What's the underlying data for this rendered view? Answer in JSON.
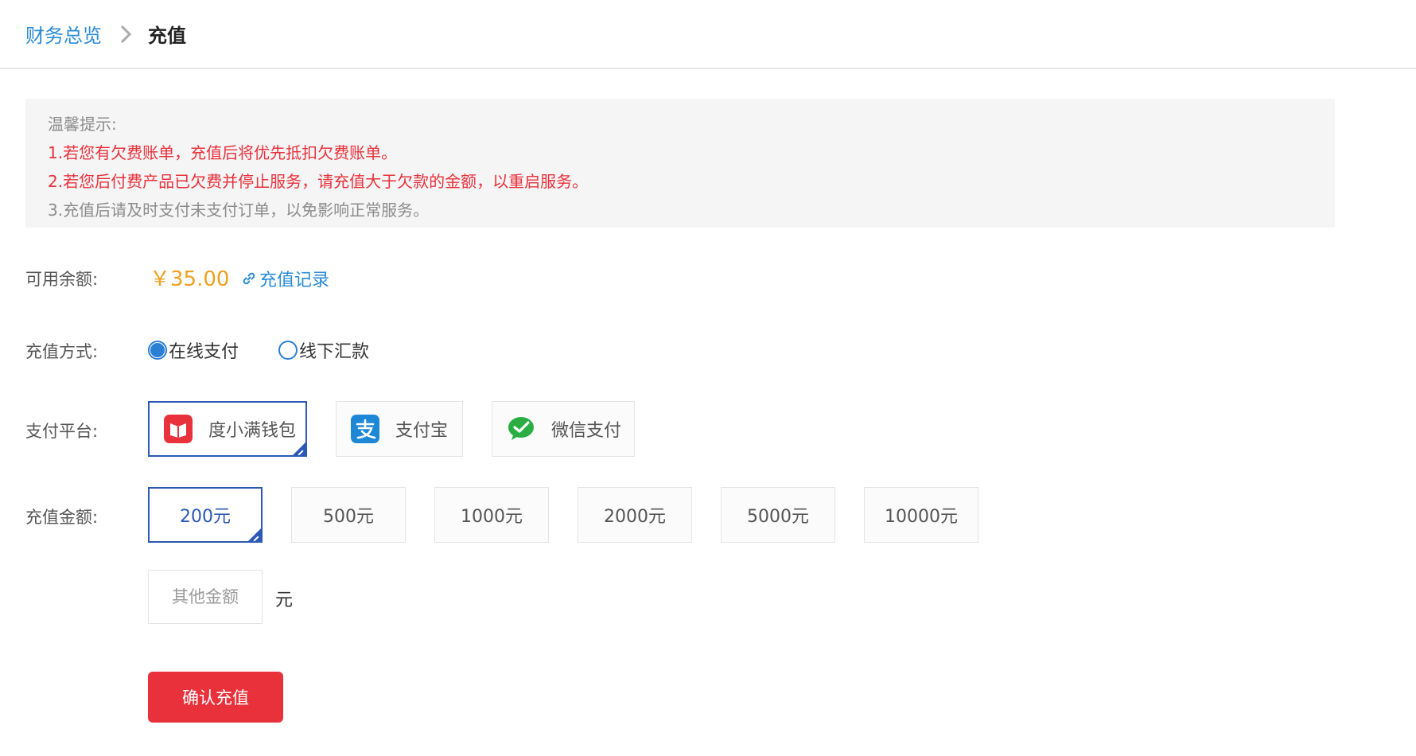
{
  "breadcrumb": {
    "parent": "财务总览",
    "current": "充值"
  },
  "notice": {
    "title": "温馨提示:",
    "items": [
      "1.若您有欠费账单，充值后将优先抵扣欠费账单。",
      "2.若您后付费产品已欠费并停止服务，请充值大于欠款的金额，以重启服务。",
      "3.充值后请及时支付未支付订单，以免影响正常服务。"
    ]
  },
  "balance": {
    "label": "可用余额:",
    "value": "￥35.00",
    "record_link": "充值记录"
  },
  "method": {
    "label": "充值方式:",
    "options": [
      "在线支付",
      "线下汇款"
    ],
    "selected": "在线支付"
  },
  "platform": {
    "label": "支付平台:",
    "options": [
      "度小满钱包",
      "支付宝",
      "微信支付"
    ],
    "selected": "度小满钱包"
  },
  "amount": {
    "label": "充值金额:",
    "options": [
      "200元",
      "500元",
      "1000元",
      "2000元",
      "5000元",
      "10000元"
    ],
    "selected": "200元",
    "other_placeholder": "其他金额",
    "unit": "元"
  },
  "confirm_label": "确认充值",
  "colors": {
    "link": "#2a8cd4",
    "danger": "#e8313b",
    "balance": "#f0a020",
    "selected_border": "#2b59b5"
  }
}
